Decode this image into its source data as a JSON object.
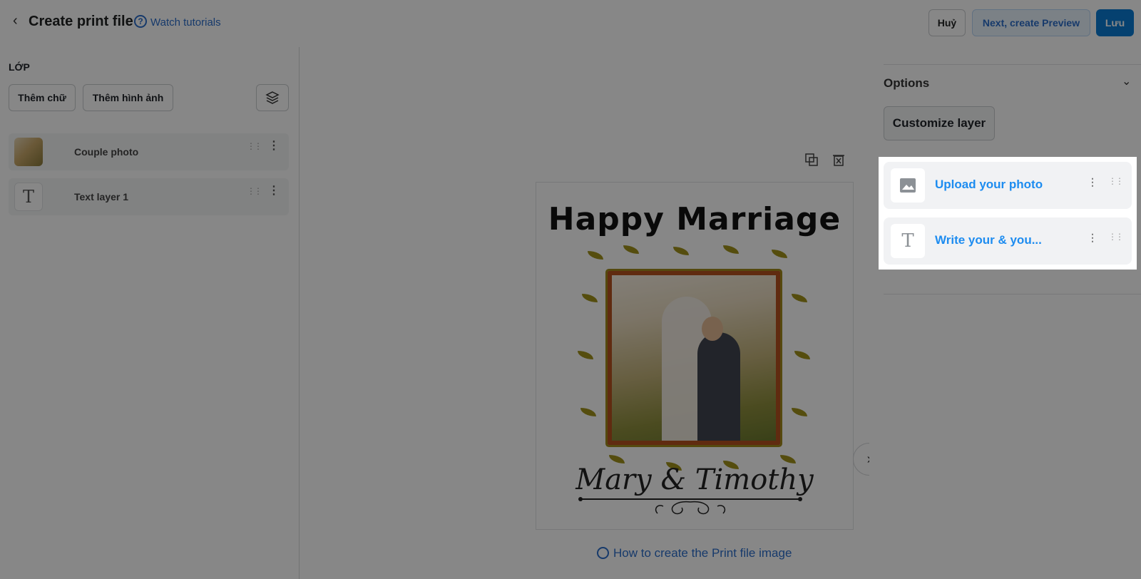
{
  "header": {
    "back_icon": "chevron-left-icon",
    "title": "Create print file",
    "help_icon": "question-circle-icon",
    "help_glyph": "?",
    "watch_link": "Watch tutorials",
    "cancel_label": "Huỷ",
    "next_label": "Next, create Preview",
    "save_label": "Lưu"
  },
  "left_panel": {
    "section_title": "LỚP",
    "add_text_label": "Thêm chữ",
    "add_image_label": "Thêm hình ảnh",
    "layers_icon": "layers-icon",
    "layers": [
      {
        "name": "Couple photo",
        "thumb": "photo-thumbnail"
      },
      {
        "name": "Text layer 1",
        "thumb": "text-icon",
        "glyph": "T"
      }
    ]
  },
  "canvas": {
    "headline": "Happy Marriage",
    "names": "Mary & Timothy",
    "help_link": "How to create the Print file image",
    "duplicate_icon": "duplicate-icon",
    "delete_icon": "delete-icon"
  },
  "right_panel": {
    "options_title": "Options",
    "customize_label": "Customize layer",
    "items": [
      {
        "label": "Upload your photo",
        "icon": "image-icon"
      },
      {
        "label": "Write your & you...",
        "icon": "text-icon",
        "glyph": "T"
      }
    ]
  },
  "colors": {
    "primary": "#0b7cd3",
    "link": "#2c6ecb",
    "option_label": "#1d8cf0",
    "overlay": "rgba(0,0,0,0.47)"
  }
}
